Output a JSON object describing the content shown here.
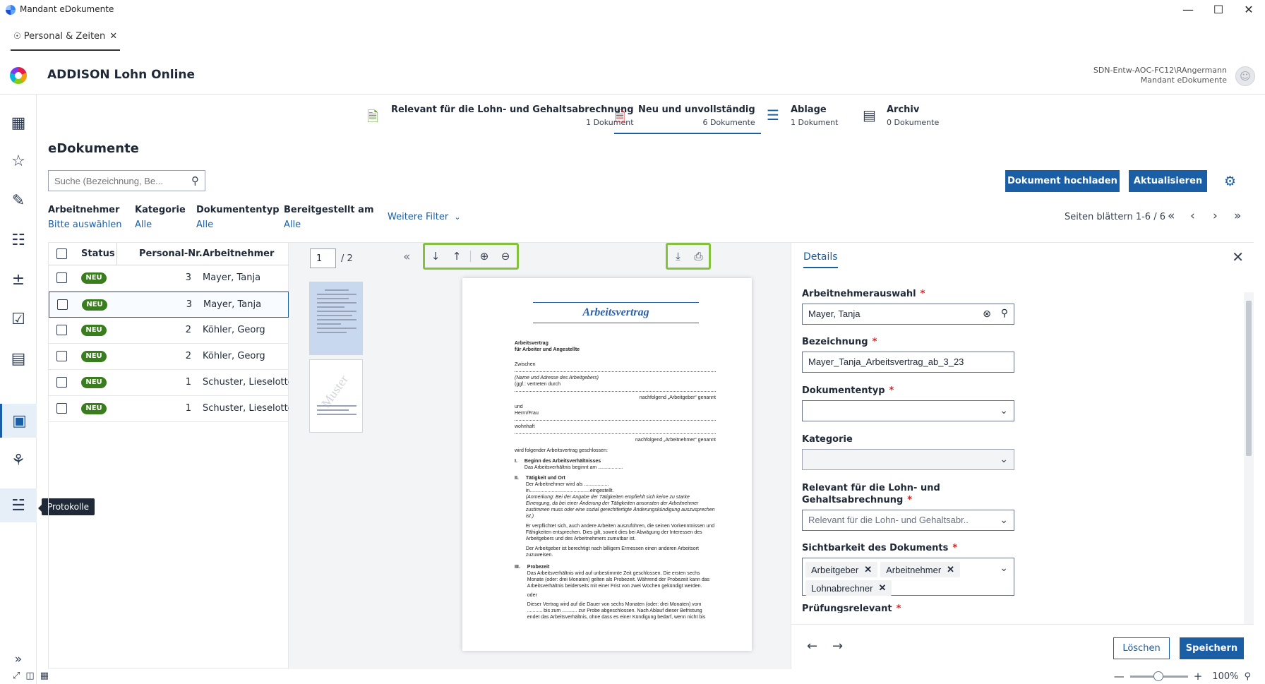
{
  "window": {
    "title": "Mandant eDokumente",
    "controls": [
      "—",
      "☐",
      "✕"
    ]
  },
  "tabbar": {
    "tab_label": "Personal & Zeiten"
  },
  "header": {
    "app_title": "ADDISON Lohn Online",
    "user_line1": "SDN-Entw-AOC-FC12\\RAngermann",
    "user_line2": "Mandant eDokumente"
  },
  "nav": {
    "icons": [
      "dashboard-icon",
      "star-icon",
      "person-edit-icon",
      "calendar-icon",
      "calculator-icon",
      "calendar-check-icon",
      "calendar-list-icon",
      "edocuments-icon",
      "groups-icon",
      "protocols-icon"
    ],
    "active_index": 7,
    "tooltip": "Protokolle",
    "expand_icon": "double-chevron-right-icon"
  },
  "view_tabs": [
    {
      "label": "Relevant für die Lohn- und Gehaltsabrechnung",
      "count": "1 Dokument",
      "icon": "document-check-icon"
    },
    {
      "label": "Neu und unvollständig",
      "count": "6 Dokumente",
      "icon": "document-new-icon",
      "active": true
    },
    {
      "label": "Ablage",
      "count": "1 Dokument",
      "icon": "list-icon"
    },
    {
      "label": "Archiv",
      "count": "0 Dokumente",
      "icon": "archive-icon"
    }
  ],
  "page": {
    "title": "eDokumente"
  },
  "search": {
    "placeholder": "Suche (Bezeichnung, Be..."
  },
  "buttons": {
    "upload": "Dokument hochladen",
    "refresh": "Aktualisieren"
  },
  "filters": [
    {
      "label": "Arbeitnehmer",
      "value": "Bitte auswählen"
    },
    {
      "label": "Kategorie",
      "value": "Alle"
    },
    {
      "label": "Dokumententyp",
      "value": "Alle"
    },
    {
      "label": "Bereitgestellt am",
      "value": "Alle"
    }
  ],
  "more_filter": "Weitere Filter",
  "pager": {
    "label": "Seiten blättern 1-6 / 6"
  },
  "table": {
    "headers": {
      "status": "Status",
      "nr": "Personal-Nr.",
      "name": "Arbeitnehmer"
    },
    "rows": [
      {
        "status": "NEU",
        "nr": "3",
        "name": "Mayer, Tanja"
      },
      {
        "status": "NEU",
        "nr": "3",
        "name": "Mayer, Tanja",
        "selected": true
      },
      {
        "status": "NEU",
        "nr": "2",
        "name": "Köhler, Georg"
      },
      {
        "status": "NEU",
        "nr": "2",
        "name": "Köhler, Georg"
      },
      {
        "status": "NEU",
        "nr": "1",
        "name": "Schuster, Lieselotte"
      },
      {
        "status": "NEU",
        "nr": "1",
        "name": "Schuster, Lieselotte"
      }
    ]
  },
  "viewer": {
    "page_current": "1",
    "page_total": "/ 2",
    "watermark": "Muster",
    "document": {
      "title": "Arbeitsvertrag",
      "heading1": "Arbeitsvertrag",
      "heading2": "für Arbeiter und Angestellte",
      "zwischen": "Zwischen",
      "name_addr": "(Name und Adresse des Arbeitgebers)",
      "vertreten": "(ggf.: vertreten durch",
      "nachfolgend_ag": "nachfolgend „Arbeitgeber“ genannt",
      "und": "und",
      "herr_frau": "Herrn/Frau",
      "wohnhaft": "wohnhaft",
      "nachfolgend_an": "nachfolgend „Arbeitnehmer“ genannt",
      "geschlossen": "wird folgender Arbeitsvertrag geschlossen:",
      "sec1_num": "I.",
      "sec1_title": "Beginn des Arbeitsverhältnisses",
      "sec1_text": "Das Arbeitsverhältnis beginnt am ..................",
      "sec2_num": "II.",
      "sec2_title": "Tätigkeit und Ort",
      "sec2_text": "Der Arbeitnehmer wird als ..................",
      "sec2_text2": "in............................................eingestellt.",
      "sec2_note": "(Anmerkung: Bei der Angabe der Tätigkeiten empfiehlt sich keine zu starke Einengung, da bei einer Änderung der Tätigkeiten ansonsten der Arbeitnehmer zustimmen muss oder eine sozial gerechtfertigte Änderungskündigung auszusprechen ist.)",
      "sec2_p1": "Er verpflichtet sich, auch andere Arbeiten auszuführen, die seinen Vorkenntnissen und Fähigkeiten entsprechen. Dies gilt, soweit dies bei Abwägung der Interessen des Arbeitgebers und des Arbeitnehmers zumutbar ist.",
      "sec2_p2": "Der Arbeitgeber ist berechtigt nach billigem Ermessen einen anderen Arbeitsort zuzuweisen.",
      "sec3_num": "III.",
      "sec3_title": "Probezeit",
      "sec3_text": "Das Arbeitsverhältnis wird auf unbestimmte Zeit geschlossen. Die ersten sechs Monate (oder: drei Monaten) gelten als Probezeit. Während der Probezeit kann das Arbeitsverhältnis beiderseits mit einer Frist von zwei Wochen gekündigt werden.",
      "oder": "oder",
      "sec3_text2": "Dieser Vertrag wird auf die Dauer von sechs Monaten (oder: drei Monaten) vom ........... bis zum ........... zur Probe abgeschlossen. Nach Ablauf dieser Befristung endet das Arbeitsverhältnis, ohne dass es einer Kündigung bedarf, wenn nicht bis"
    }
  },
  "details": {
    "tab": "Details",
    "fields": {
      "arbeitnehmer_label": "Arbeitnehmerauswahl",
      "arbeitnehmer_value": "Mayer, Tanja",
      "bezeichnung_label": "Bezeichnung",
      "bezeichnung_value": "Mayer_Tanja_Arbeitsvertrag_ab_3_23",
      "dokumententyp_label": "Dokumententyp",
      "kategorie_label": "Kategorie",
      "relevant_label_1": "Relevant für die Lohn- und",
      "relevant_label_2": "Gehaltsabrechnung",
      "relevant_value": "Relevant für die Lohn- und Gehaltsabr..",
      "sichtbarkeit_label": "Sichtbarkeit des Dokuments",
      "chips": [
        "Arbeitgeber",
        "Arbeitnehmer",
        "Lohnabrechner"
      ],
      "pruefung_label": "Prüfungsrelevant",
      "required_mark": "*"
    },
    "buttons": {
      "delete": "Löschen",
      "save": "Speichern"
    }
  },
  "statusbar": {
    "zoom": "100%"
  }
}
